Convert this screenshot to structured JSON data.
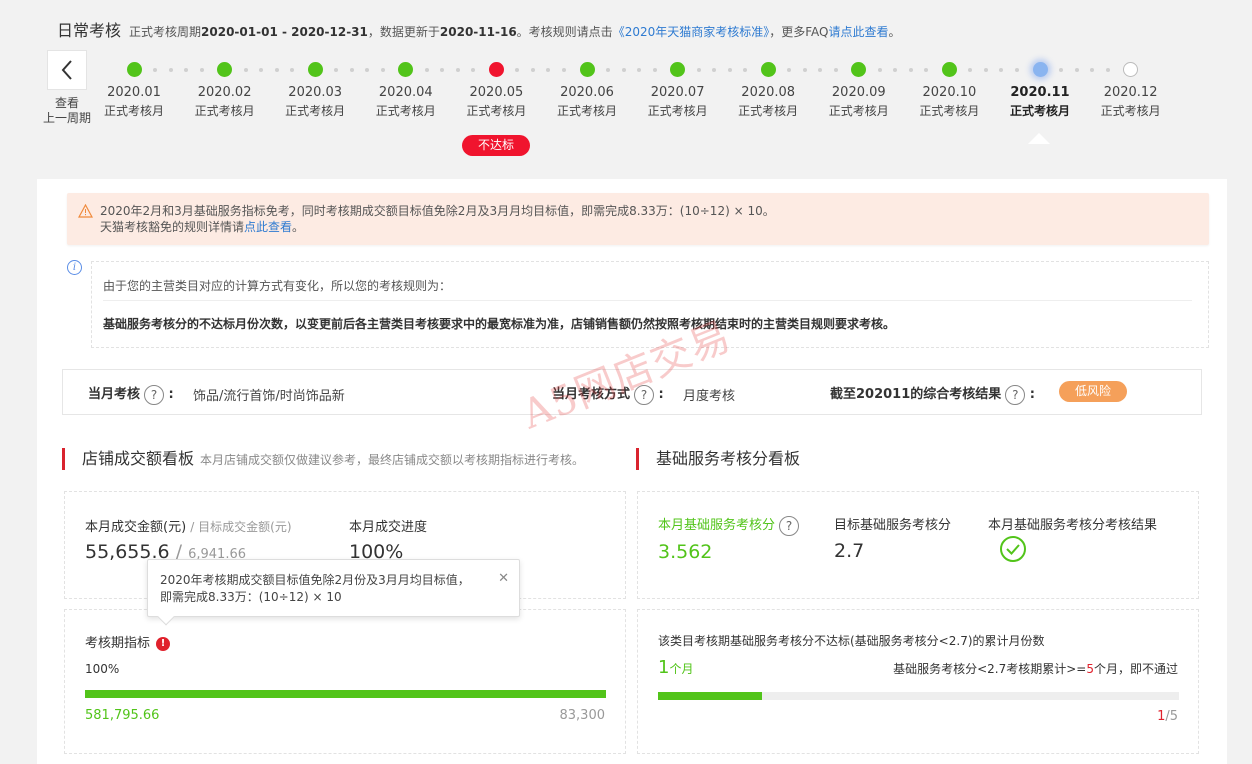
{
  "header": {
    "title": "日常考核",
    "period_prefix": "正式考核周期",
    "period": "2020-01-01 - 2020-12-31",
    "update_prefix": "，数据更新于",
    "update_date": "2020-11-16",
    "rule_prefix": "。考核规则请点击",
    "rule_link": "《2020年天猫商家考核标准》",
    "faq_prefix": "，更多FAQ",
    "faq_link": "请点此查看",
    "faq_suffix": "。"
  },
  "back": {
    "line1": "查看",
    "line2": "上一周期"
  },
  "timeline": [
    {
      "month": "2020.01",
      "label": "正式考核月",
      "status": "ok"
    },
    {
      "month": "2020.02",
      "label": "正式考核月",
      "status": "ok"
    },
    {
      "month": "2020.03",
      "label": "正式考核月",
      "status": "ok"
    },
    {
      "month": "2020.04",
      "label": "正式考核月",
      "status": "ok"
    },
    {
      "month": "2020.05",
      "label": "正式考核月",
      "status": "fail"
    },
    {
      "month": "2020.06",
      "label": "正式考核月",
      "status": "ok"
    },
    {
      "month": "2020.07",
      "label": "正式考核月",
      "status": "ok"
    },
    {
      "month": "2020.08",
      "label": "正式考核月",
      "status": "ok"
    },
    {
      "month": "2020.09",
      "label": "正式考核月",
      "status": "ok"
    },
    {
      "month": "2020.10",
      "label": "正式考核月",
      "status": "ok"
    },
    {
      "month": "2020.11",
      "label": "正式考核月",
      "status": "current"
    },
    {
      "month": "2020.12",
      "label": "正式考核月",
      "status": "future"
    }
  ],
  "fail_badge": "不达标",
  "warning": {
    "line1": "2020年2月和3月基础服务指标免考，同时考核期成交额目标值免除2月及3月月均目标值，即需完成8.33万：(10÷12) × 10。",
    "line2_prefix": "天猫考核豁免的规则详情请",
    "line2_link": "点此查看",
    "line2_suffix": "。"
  },
  "rule": {
    "line1": "由于您的主营类目对应的计算方式有变化，所以您的考核规则为：",
    "line2": "基础服务考核分的不达标月份次数，以变更前后各主营类目考核要求中的最宽标准为准，店铺销售额仍然按照考核期结束时的主营类目规则要求考核。"
  },
  "current": {
    "assess_label": "当月考核",
    "assess_value": "饰品/流行首饰/时尚饰品新",
    "method_label": "当月考核方式",
    "method_value": "月度考核",
    "result_label": "截至202011的综合考核结果",
    "result_value": "低风险"
  },
  "watermark": "A5网店交易",
  "sales": {
    "title": "店铺成交额看板",
    "subtitle": "本月店铺成交额仅做建议参考，最终店铺成交额以考核期指标进行考核。",
    "amount_label": "本月成交金额(元)",
    "target_label": "/ 目标成交金额(元)",
    "amount": "55,655.6",
    "slash": "/",
    "target": "6,941.66",
    "progress_label": "本月成交进度",
    "progress": "100%",
    "period_label": "考核期指标",
    "period_percent": "100%",
    "period_fill": 1.0,
    "period_value": "581,795.66",
    "period_target": "83,300"
  },
  "tooltip": {
    "line1": "2020年考核期成交额目标值免除2月份及3月月均目标值，",
    "line2": "即需完成8.33万：(10÷12) × 10"
  },
  "service": {
    "title": "基础服务考核分看板",
    "score_label": "本月基础服务考核分",
    "score": "3.562",
    "target_label": "目标基础服务考核分",
    "target": "2.7",
    "result_label": "本月基础服务考核分考核结果",
    "fail_count_desc": "该类目考核期基础服务考核分不达标(基础服务考核分<2.7)的累计月份数",
    "fail_count": "1",
    "fail_unit": "个月",
    "rule_prefix": "基础服务考核分<2.7考核期累计>=",
    "rule_num": "5",
    "rule_suffix": "个月，即不通过",
    "fail_fill": 0.2,
    "pager_current": "1",
    "pager_total": "/5"
  },
  "colors": {
    "ok": "#52c41a",
    "fail": "#f0142e",
    "current": "#8ab4f0",
    "accent_red": "#d9232e",
    "link": "#2f7bd1",
    "risk": "#f5a05a"
  }
}
